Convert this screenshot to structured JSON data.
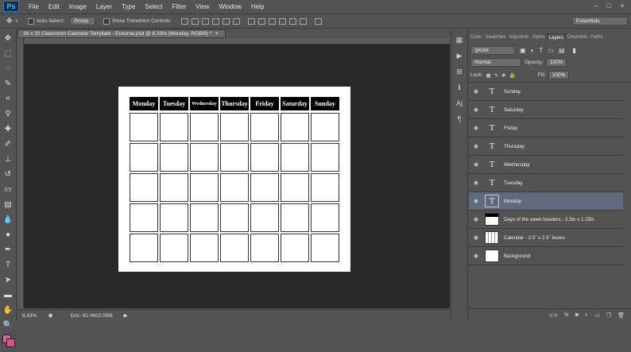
{
  "app": {
    "logo": "Ps"
  },
  "menu": [
    "File",
    "Edit",
    "Image",
    "Layer",
    "Type",
    "Select",
    "Filter",
    "View",
    "Window",
    "Help"
  ],
  "window_controls": [
    "–",
    "□",
    "×"
  ],
  "options": {
    "auto_select_label": "Auto-Select:",
    "auto_select_value": "Group",
    "show_transform_label": "Show Transform Controls",
    "workspace": "Essentials"
  },
  "document": {
    "tab_title": "16 x 20 Classroom Calendar Template - Ecourse.psd @ 8.33% (Monday, RGB/8) *",
    "zoom": "8.33%",
    "doc_size": "Doc: 82.4M/2.00M"
  },
  "calendar": {
    "days": [
      "Monday",
      "Tuesday",
      "Wednesday",
      "Thursday",
      "Friday",
      "Saturday",
      "Sunday"
    ]
  },
  "panel": {
    "tabs": [
      "Color",
      "Swatches",
      "Adjustme",
      "Styles",
      "Layers",
      "Channels",
      "Paths"
    ],
    "active_tab": "Layers",
    "filter_kind": "Kind",
    "blend_mode": "Normal",
    "opacity_label": "Opacity:",
    "opacity_value": "100%",
    "lock_label": "Lock:",
    "fill_label": "Fill:",
    "fill_value": "100%"
  },
  "layers": [
    {
      "name": "Sunday",
      "thumb": "T",
      "selected": false
    },
    {
      "name": "Saturday",
      "thumb": "T",
      "selected": false
    },
    {
      "name": "Friday",
      "thumb": "T",
      "selected": false
    },
    {
      "name": "Thursday",
      "thumb": "T",
      "selected": false
    },
    {
      "name": "Wednesday",
      "thumb": "T",
      "selected": false
    },
    {
      "name": "Tuesday",
      "thumb": "T",
      "selected": false
    },
    {
      "name": "Monday",
      "thumb": "T",
      "selected": true
    },
    {
      "name": "Days of the week headers - 2.5in x 1.25in",
      "thumb": "",
      "selected": false
    },
    {
      "name": "Calendar - 2.5\" x 2.5\" boxes",
      "thumb": "",
      "selected": false
    },
    {
      "name": "Background",
      "thumb": "",
      "selected": false
    }
  ],
  "colors": {
    "foreground": "#d4689a",
    "background": "#e84a8a",
    "selected_layer": "#5f6b7b"
  }
}
